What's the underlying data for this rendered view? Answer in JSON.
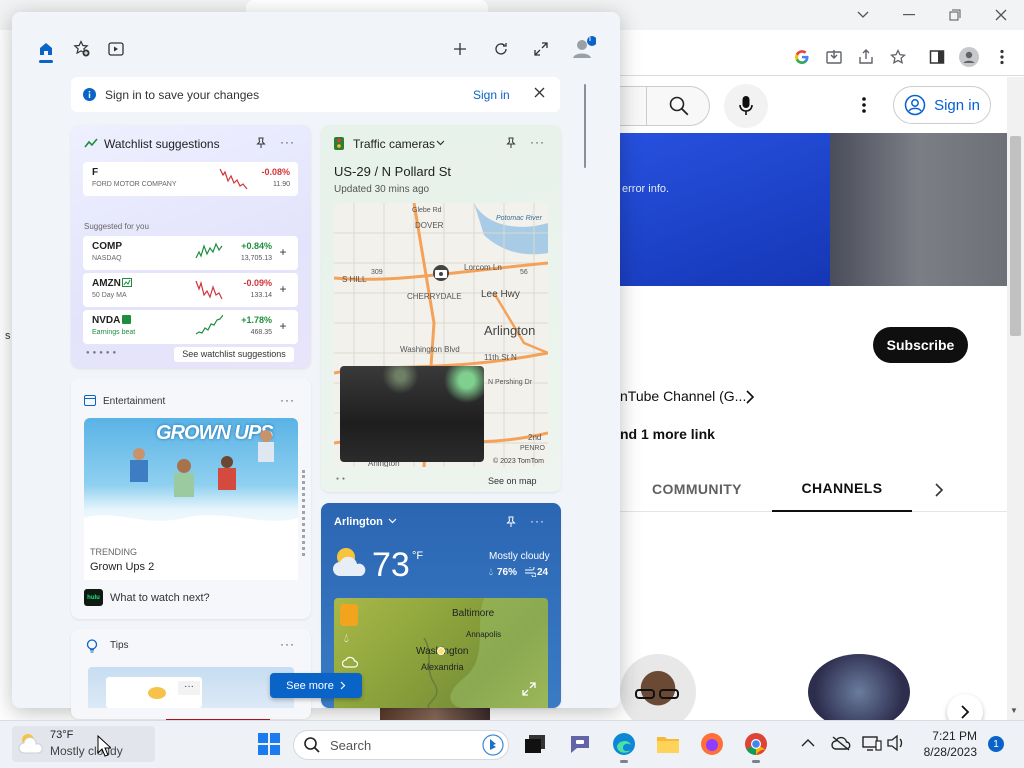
{
  "chrome": {
    "tab_title": "",
    "window_controls": [
      "chevron-down-icon",
      "minimize-icon",
      "restore-icon",
      "close-icon"
    ]
  },
  "youtube": {
    "signin_label": "Sign in",
    "banner_text": "error info.",
    "subscribe_label": "Subscribe",
    "channel_link": "nTube Channel (G...",
    "more_links": "nd 1 more link",
    "tabs": [
      "COMMUNITY",
      "CHANNELS"
    ],
    "active_tab": "CHANNELS",
    "left_edge_char": "s"
  },
  "widgets": {
    "signin_banner": {
      "text": "Sign in to save your changes",
      "link": "Sign in"
    },
    "watchlist": {
      "title": "Watchlist suggestions",
      "top": {
        "symbol": "F",
        "name": "FORD MOTOR COMPANY",
        "change": "-0.08%",
        "price": "11.90",
        "trend": "down"
      },
      "suggested_label": "Suggested for you",
      "items": [
        {
          "symbol": "COMP",
          "sub": "NASDAQ",
          "change": "+0.84%",
          "price": "13,705.13",
          "trend": "up"
        },
        {
          "symbol": "AMZN",
          "sub": "50 Day MA",
          "change": "-0.09%",
          "price": "133.14",
          "trend": "down"
        },
        {
          "symbol": "NVDA",
          "sub": "Earnings beat",
          "change": "+1.78%",
          "price": "468.35",
          "trend": "up"
        }
      ],
      "footer_link": "See watchlist suggestions"
    },
    "traffic": {
      "title": "Traffic cameras",
      "location": "US-29 / N Pollard St",
      "updated": "Updated 30 mins ago",
      "map_labels": [
        "DOVER",
        "Potomac River",
        "S HILL",
        "Glebe Rd",
        "Lorcom Ln",
        "309",
        "56",
        "CHERRYDALE",
        "Lee Hwy",
        "Arlington",
        "Washington Blvd",
        "11th St N",
        "N Pershing Dr",
        "2nd",
        "PENRO",
        "Arlington"
      ],
      "copyright": "© 2023 TomTom",
      "footer_link": "See on map"
    },
    "entertainment": {
      "title": "Entertainment",
      "poster_text": "GROWN UPS",
      "trending_label": "TRENDING",
      "movie_title": "Grown Ups 2",
      "provider_badge": "hulu",
      "cta": "What to watch next?"
    },
    "weather": {
      "location": "Arlington",
      "temp": "73",
      "unit": "°F",
      "condition": "Mostly cloudy",
      "humidity": "76%",
      "wind": "24",
      "map_labels": [
        "Baltimore",
        "Annapolis",
        "Washington",
        "Alexandria"
      ]
    },
    "tips": {
      "title": "Tips"
    },
    "see_more": "See more"
  },
  "taskbar": {
    "weather_temp": "73°F",
    "weather_condition": "Mostly cloudy",
    "search_placeholder": "Search",
    "time": "7:21 PM",
    "date": "8/28/2023",
    "notification_count": "1",
    "profile_badge": "i"
  }
}
